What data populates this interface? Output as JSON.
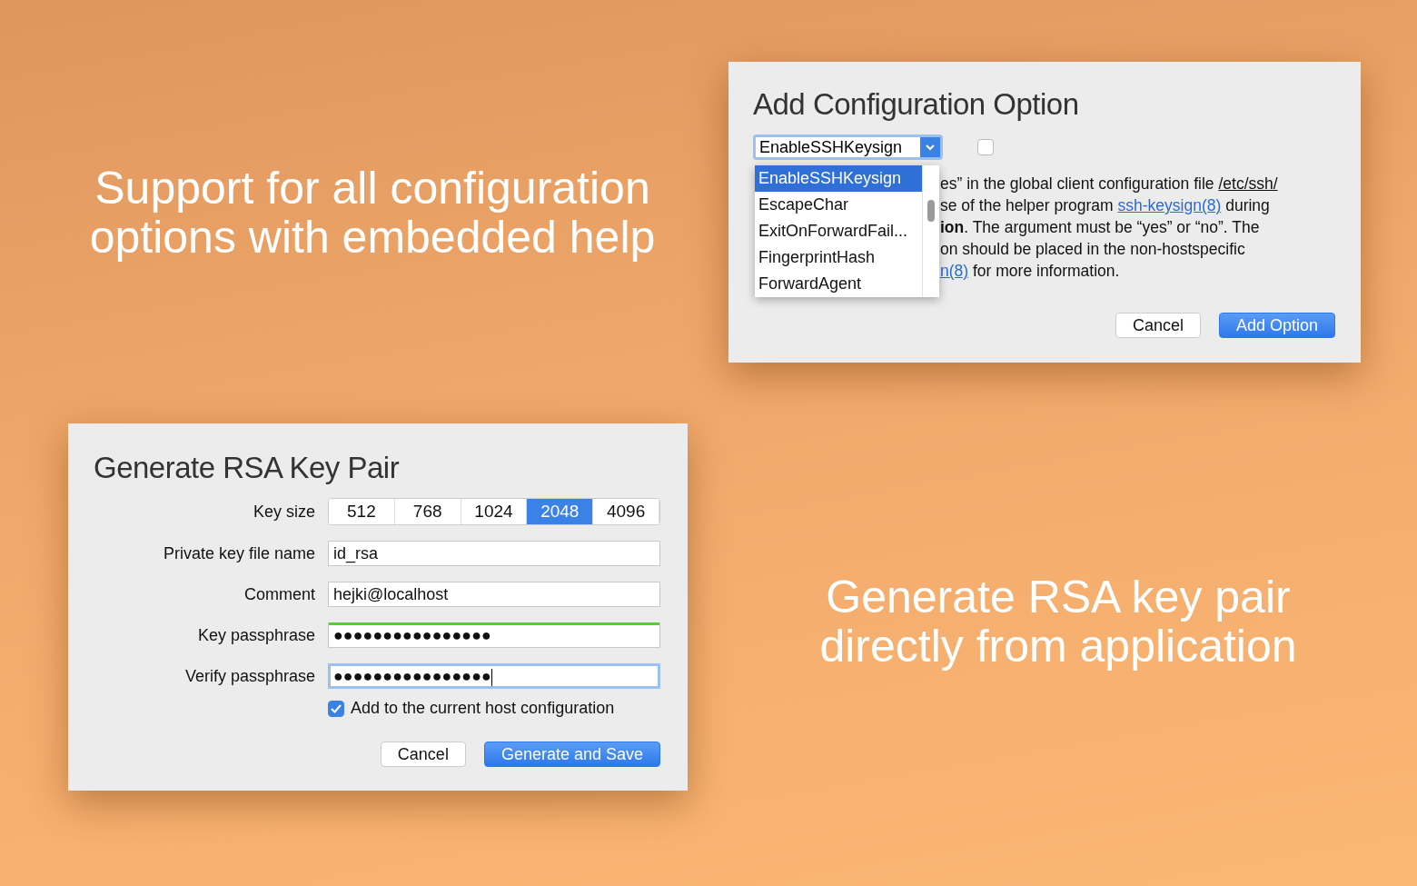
{
  "captions": [
    {
      "text": "Support for all configuration options with embedded help"
    },
    {
      "text": "Generate RSA key pair directly from application"
    }
  ],
  "config_dialog": {
    "title": "Add Configuration Option",
    "combo": {
      "value": "EnableSSHKeysign",
      "expanded": true
    },
    "enabled_checkbox": {
      "checked": false
    },
    "options": [
      {
        "label": "EnableSSHKeysign",
        "selected": true
      },
      {
        "label": "EscapeChar",
        "selected": false
      },
      {
        "label": "ExitOnForwardFail...",
        "selected": false
      },
      {
        "label": "FingerprintHash",
        "selected": false
      },
      {
        "label": "ForwardAgent",
        "selected": false
      }
    ],
    "help_lines": [
      [
        {
          "kind": "plain",
          "text": "es” in the global client configuration file "
        },
        {
          "kind": "path",
          "text": "/etc/ssh/"
        }
      ],
      [
        {
          "kind": "plain",
          "text": "se of the helper program "
        },
        {
          "kind": "link",
          "text": "ssh-keysign(8)"
        },
        {
          "kind": "plain",
          "text": " during"
        }
      ],
      [
        {
          "kind": "bold",
          "text": "ion"
        },
        {
          "kind": "plain",
          "text": ". The argument must be “yes” or “no”. The"
        }
      ],
      [
        {
          "kind": "plain",
          "text": "on should be placed in the non-hostspecific"
        }
      ],
      [
        {
          "kind": "link",
          "text": "n(8)"
        },
        {
          "kind": "plain",
          "text": " for more information."
        }
      ]
    ],
    "buttons": [
      {
        "label": "Cancel",
        "kind": "secondary"
      },
      {
        "label": "Add Option",
        "kind": "primary"
      }
    ]
  },
  "key_dialog": {
    "title": "Generate RSA Key Pair",
    "key_size": {
      "label": "Key size",
      "options": [
        {
          "label": "512",
          "selected": false
        },
        {
          "label": "768",
          "selected": false
        },
        {
          "label": "1024",
          "selected": false
        },
        {
          "label": "2048",
          "selected": true
        },
        {
          "label": "4096",
          "selected": false
        }
      ]
    },
    "fields": [
      {
        "label": "Private key file name",
        "value": "id_rsa",
        "focused": false
      },
      {
        "label": "Comment",
        "value": "hejki@localhost",
        "focused": false
      },
      {
        "label": "Key passphrase",
        "value": "●●●●●●●●●●●●●●●●",
        "focused": false,
        "level": 1
      },
      {
        "label": "Verify passphrase",
        "value": "●●●●●●●●●●●●●●●●",
        "focused": true
      }
    ],
    "add_to_host": {
      "label": "Add to the current host configuration",
      "checked": true
    },
    "buttons": [
      {
        "label": "Cancel",
        "kind": "secondary"
      },
      {
        "label": "Generate and Save",
        "kind": "primary"
      }
    ]
  }
}
